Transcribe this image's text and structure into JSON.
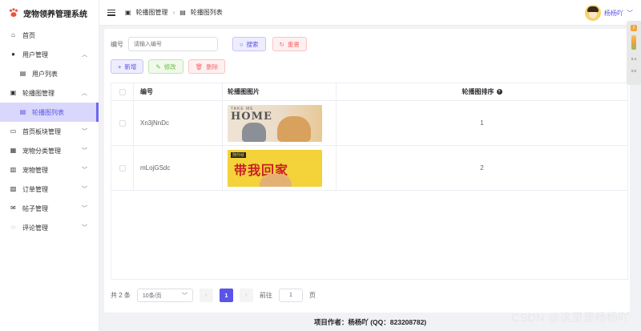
{
  "app": {
    "title": "宠物领养管理系统"
  },
  "sidebar": {
    "items": [
      {
        "label": "首页",
        "icon": "home-icon",
        "has_children": false
      },
      {
        "label": "用户管理",
        "icon": "user-icon",
        "has_children": true,
        "expanded": true
      },
      {
        "label": "用户列表",
        "icon": "list-icon",
        "sub": true
      },
      {
        "label": "轮播图管理",
        "icon": "image-icon",
        "has_children": true,
        "expanded": true
      },
      {
        "label": "轮播图列表",
        "icon": "list-icon",
        "sub": true,
        "active": true
      },
      {
        "label": "首页板块管理",
        "icon": "picture-icon",
        "has_children": true
      },
      {
        "label": "宠物分类管理",
        "icon": "grid-icon",
        "has_children": true
      },
      {
        "label": "宠物管理",
        "icon": "gift-icon",
        "has_children": true
      },
      {
        "label": "订单管理",
        "icon": "order-icon",
        "has_children": true
      },
      {
        "label": "帖子管理",
        "icon": "mail-icon",
        "has_children": true
      },
      {
        "label": "评论管理",
        "icon": "comment-icon",
        "has_children": true
      }
    ]
  },
  "header": {
    "breadcrumb": [
      "轮播图管理",
      "轮播图列表"
    ],
    "user_name": "杨杨吖"
  },
  "search": {
    "id_label": "编号",
    "id_placeholder": "请输入编号",
    "query_label": "搜索",
    "reset_label": "重置"
  },
  "actions": {
    "add_label": "新增",
    "edit_label": "修改",
    "delete_label": "删除"
  },
  "table": {
    "columns": [
      "编号",
      "轮播图图片",
      "轮播图排序"
    ],
    "rows": [
      {
        "id": "Xn3jNnDc",
        "image_text": [
          "TAKE ME",
          "HOME"
        ],
        "sort": "1"
      },
      {
        "id": "mLojGSdc",
        "image_text": [
          "随你就",
          "带我回家"
        ],
        "sort": "2"
      }
    ]
  },
  "pagination": {
    "total_text": "共 2 条",
    "page_size": "10条/页",
    "current_page": "1",
    "goto_label": "前往",
    "goto_value": "1",
    "page_unit": "页"
  },
  "footer": {
    "text": "项目作者：杨杨吖 (QQ：823208782)"
  },
  "watermark": "CSDN @这里是杨杨吖",
  "widget": {
    "badge": "2",
    "stat1": "0.4",
    "stat2": "0.0"
  },
  "colors": {
    "primary": "#5a54e8",
    "danger": "#f56c6c",
    "success": "#67c23a"
  }
}
